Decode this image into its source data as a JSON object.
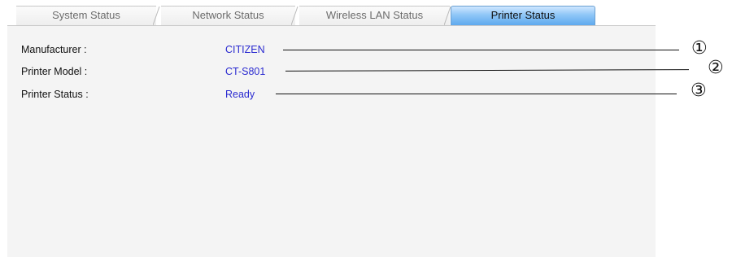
{
  "tabs": [
    {
      "label": "System Status",
      "active": false
    },
    {
      "label": "Network Status",
      "active": false
    },
    {
      "label": "Wireless LAN Status",
      "active": false
    },
    {
      "label": "Printer Status",
      "active": true
    }
  ],
  "fields": [
    {
      "label": "Manufacturer :",
      "value": "CITIZEN",
      "callout": "①"
    },
    {
      "label": "Printer Model :",
      "value": "CT-S801",
      "callout": "②"
    },
    {
      "label": "Printer Status :",
      "value": "Ready",
      "callout": "③"
    }
  ],
  "colors": {
    "value_text": "#2a2ad0",
    "active_tab": "#5ea9ee",
    "panel_bg": "#f4f4f4"
  }
}
